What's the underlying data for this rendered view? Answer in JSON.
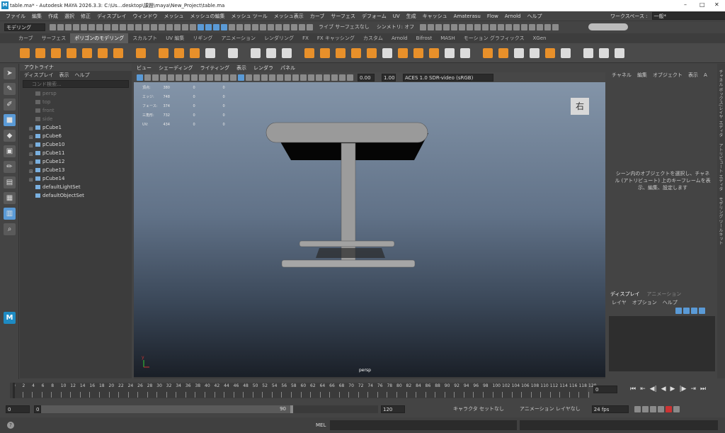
{
  "app": {
    "title": "table.ma* - Autodesk MAYA 2026.3.3: C:\\Us…desktop\\課題\\maya\\New_Project\\table.ma",
    "icon_letter": "M"
  },
  "window_controls": {
    "minimize": "–",
    "maximize": "□",
    "close": "✕"
  },
  "menubar": {
    "items": [
      "ファイル",
      "編集",
      "作成",
      "選択",
      "修正",
      "ディスプレイ",
      "ウィンドウ",
      "メッシュ",
      "メッシュの編集",
      "メッシュ ツール",
      "メッシュ表示",
      "カーブ",
      "サーフェス",
      "デフォーム",
      "UV",
      "生成",
      "キャッシュ",
      "Amaterasu",
      "Flow",
      "Arnold",
      "ヘルプ"
    ],
    "workspace_label": "ワークスペース :",
    "workspace_value": "一般*"
  },
  "statusline": {
    "mode": "モデリング",
    "symmetry": "シンメトリ: オフ",
    "live": "ライブ サーフェスなし"
  },
  "shelf": {
    "tabs": [
      "カーブ",
      "サーフェス",
      "ポリゴンのモデリング",
      "スカルプト",
      "UV 編集",
      "リギング",
      "アニメーション",
      "レンダリング",
      "FX",
      "FX キャッシング",
      "カスタム",
      "Arnold",
      "Bifrost",
      "MASH",
      "モーション グラフィックス",
      "XGen"
    ],
    "active": 2
  },
  "outliner": {
    "title": "アウトライナ",
    "menu": [
      "ディスプレイ",
      "表示",
      "ヘルプ"
    ],
    "search_placeholder": "コンド検索...",
    "items": [
      {
        "label": "persp",
        "dim": true,
        "expandable": false
      },
      {
        "label": "top",
        "dim": true,
        "expandable": false
      },
      {
        "label": "front",
        "dim": true,
        "expandable": false
      },
      {
        "label": "side",
        "dim": true,
        "expandable": false
      },
      {
        "label": "pCube1",
        "dim": false,
        "expandable": true
      },
      {
        "label": "pCube6",
        "dim": false,
        "expandable": true
      },
      {
        "label": "pCube10",
        "dim": false,
        "expandable": true
      },
      {
        "label": "pCube11",
        "dim": false,
        "expandable": true
      },
      {
        "label": "pCube12",
        "dim": false,
        "expandable": true
      },
      {
        "label": "pCube13",
        "dim": false,
        "expandable": true
      },
      {
        "label": "pCube14",
        "dim": false,
        "expandable": true
      },
      {
        "label": "defaultLightSet",
        "dim": false,
        "expandable": false
      },
      {
        "label": "defaultObjectSet",
        "dim": false,
        "expandable": false
      }
    ]
  },
  "viewport": {
    "menu": [
      "ビュー",
      "シェーディング",
      "ライティング",
      "表示",
      "レンダラ",
      "パネル"
    ],
    "exposure": "0.00",
    "gamma": "1.00",
    "colorspace": "ACES 1.0 SDR-video (sRGB)",
    "camera": "persp",
    "viewcube_label": "右",
    "hud": [
      {
        "label": "頂点:",
        "a": "380",
        "b": "0",
        "c": "0"
      },
      {
        "label": "エッジ:",
        "a": "748",
        "b": "0",
        "c": "0"
      },
      {
        "label": "フェース:",
        "a": "374",
        "b": "0",
        "c": "0"
      },
      {
        "label": "三角形:",
        "a": "732",
        "b": "0",
        "c": "0"
      },
      {
        "label": "UV:",
        "a": "434",
        "b": "0",
        "c": "0"
      }
    ]
  },
  "channelbox": {
    "menu": [
      "チャネル",
      "編集",
      "オブジェクト",
      "表示"
    ],
    "extra": "A",
    "message": "シーン内のオブジェクトを選択し、チャネル (アトリビュート) 上のキーフレームを表示、編集、設定します",
    "layer_tabs": [
      "ディスプレイ",
      "アニメーション"
    ],
    "layer_menu": [
      "レイヤ",
      "オプション",
      "ヘルプ"
    ]
  },
  "side_tabs": [
    "チャネル ボックス/レイヤ エディタ",
    "アトリビュート エディタ",
    "モデリング ツールキット"
  ],
  "timeline": {
    "ticks": [
      "0",
      "2",
      "4",
      "6",
      "8",
      "10",
      "12",
      "14",
      "16",
      "18",
      "20",
      "22",
      "24",
      "26",
      "28",
      "30",
      "32",
      "34",
      "36",
      "38",
      "40",
      "42",
      "44",
      "46",
      "48",
      "50",
      "52",
      "54",
      "56",
      "58",
      "60",
      "62",
      "64",
      "66",
      "68",
      "70",
      "72",
      "74",
      "76",
      "78",
      "80",
      "82",
      "84",
      "86",
      "88",
      "90",
      "92",
      "94",
      "96",
      "98",
      "100",
      "102",
      "104",
      "106",
      "108",
      "110",
      "112",
      "114",
      "116",
      "118",
      "120"
    ],
    "current": "0"
  },
  "range": {
    "start": "0",
    "inner_start": "0",
    "inner_end": "90",
    "end": "120",
    "character": "キャラクタ セットなし",
    "anim_layer": "アニメーション レイヤなし",
    "fps": "24 fps"
  },
  "cmdline": {
    "label": "MEL",
    "help": "?"
  },
  "colors": {
    "accent": "#5a9ad6",
    "shelf_orange": "#e8902a",
    "viewport_top": "#8394a8"
  }
}
